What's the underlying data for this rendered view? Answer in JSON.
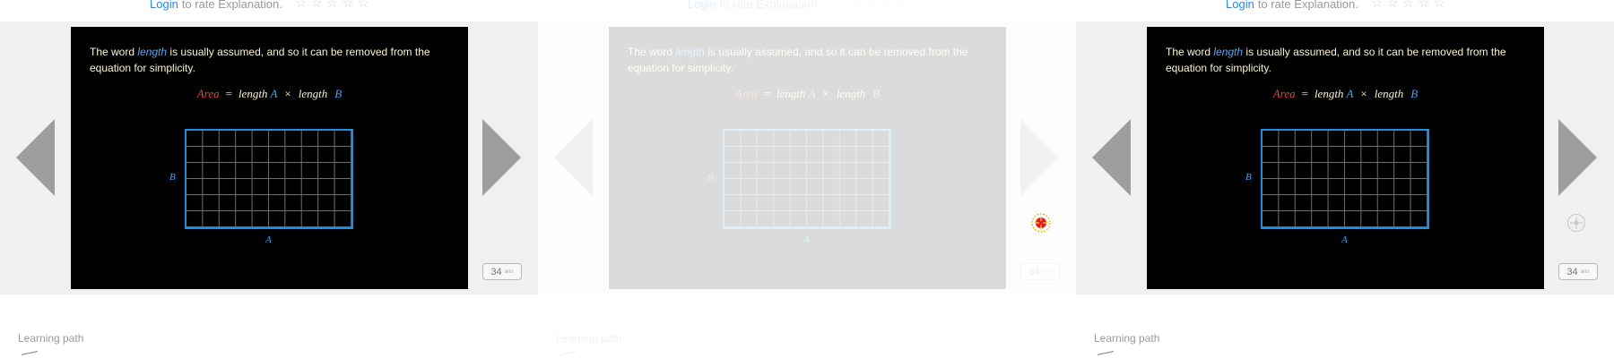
{
  "rating": {
    "login_label": "Login",
    "rate_text": "to rate Explanation.",
    "stars": [
      "☆",
      "☆",
      "☆",
      "☆",
      "☆"
    ]
  },
  "slide": {
    "text_before": "The word ",
    "term": "length",
    "text_after": " is usually assumed, and so it can be removed from the equation for simplicity.",
    "formula": {
      "area": "Area",
      "equals": "=",
      "length1": "length",
      "var_a": "A",
      "times": "×",
      "length2": "length",
      "var_b": "B"
    },
    "dim_b": "B",
    "dim_a": "A"
  },
  "nav": {
    "counter_value": "34",
    "counter_unit": "ano"
  },
  "footer": {
    "learning_path_label": "Learning path"
  },
  "colors": {
    "accent_blue": "#1e8fe3",
    "area_red": "#e5473a",
    "arrow_gray": "#9e9e9e",
    "target_red": "#e31b1b",
    "target_ring": "#e0b400"
  },
  "icons": {
    "prev": "prev-arrow-icon",
    "next": "next-arrow-icon",
    "target": "crosshair-target-icon",
    "learning_path": "learning-path-icon"
  }
}
